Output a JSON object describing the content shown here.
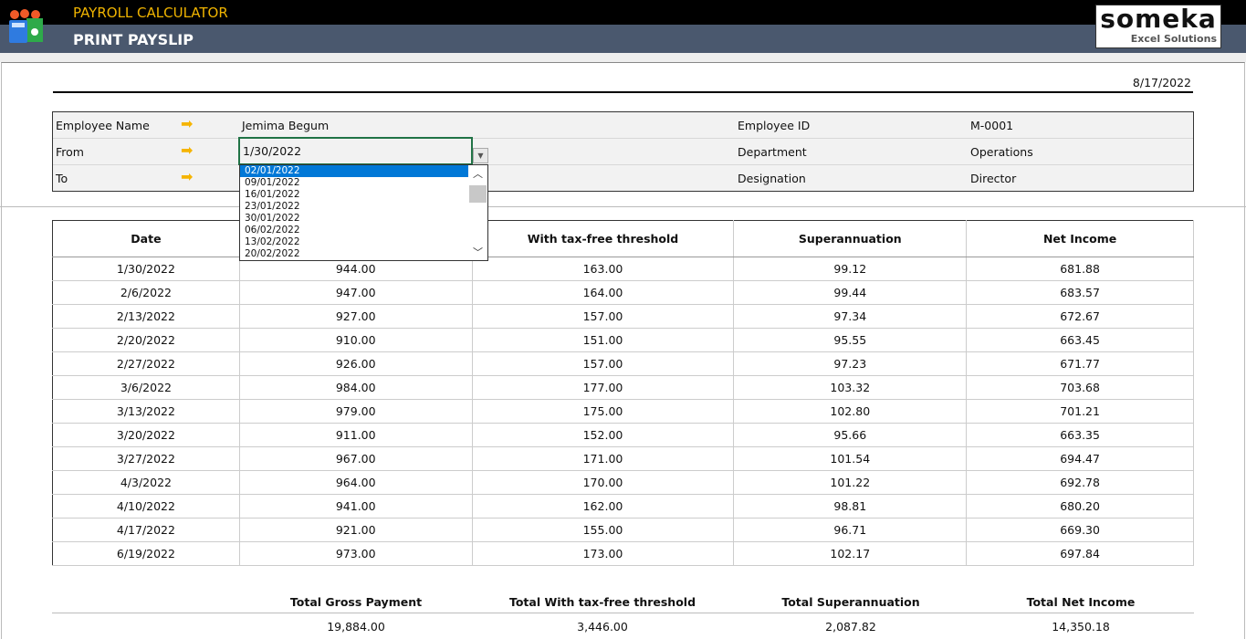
{
  "header": {
    "app_title": "PAYROLL CALCULATOR",
    "page_title": "PRINT PAYSLIP",
    "logo_main": "someka",
    "logo_sub": "Excel Solutions"
  },
  "date": "8/17/2022",
  "info": {
    "employee_name_label": "Employee Name",
    "employee_name": "Jemima Begum",
    "from_label": "From",
    "from": "1/30/2022",
    "to_label": "To",
    "employee_id_label": "Employee ID",
    "employee_id": "M-0001",
    "department_label": "Department",
    "department": "Operations",
    "designation_label": "Designation",
    "designation": "Director"
  },
  "dropdown": {
    "options": [
      "02/01/2022",
      "09/01/2022",
      "16/01/2022",
      "23/01/2022",
      "30/01/2022",
      "06/02/2022",
      "13/02/2022",
      "20/02/2022"
    ],
    "selected": "02/01/2022"
  },
  "table": {
    "headers": [
      "Date",
      "",
      "With tax-free threshold",
      "Superannuation",
      "Net Income"
    ],
    "rows": [
      [
        "1/30/2022",
        "944.00",
        "163.00",
        "99.12",
        "681.88"
      ],
      [
        "2/6/2022",
        "947.00",
        "164.00",
        "99.44",
        "683.57"
      ],
      [
        "2/13/2022",
        "927.00",
        "157.00",
        "97.34",
        "672.67"
      ],
      [
        "2/20/2022",
        "910.00",
        "151.00",
        "95.55",
        "663.45"
      ],
      [
        "2/27/2022",
        "926.00",
        "157.00",
        "97.23",
        "671.77"
      ],
      [
        "3/6/2022",
        "984.00",
        "177.00",
        "103.32",
        "703.68"
      ],
      [
        "3/13/2022",
        "979.00",
        "175.00",
        "102.80",
        "701.21"
      ],
      [
        "3/20/2022",
        "911.00",
        "152.00",
        "95.66",
        "663.35"
      ],
      [
        "3/27/2022",
        "967.00",
        "171.00",
        "101.54",
        "694.47"
      ],
      [
        "4/3/2022",
        "964.00",
        "170.00",
        "101.22",
        "692.78"
      ],
      [
        "4/10/2022",
        "941.00",
        "162.00",
        "98.81",
        "680.20"
      ],
      [
        "4/17/2022",
        "921.00",
        "155.00",
        "96.71",
        "669.30"
      ],
      [
        "6/19/2022",
        "973.00",
        "173.00",
        "102.17",
        "697.84"
      ]
    ]
  },
  "totals": [
    {
      "label": "Total Gross Payment",
      "value": "19,884.00"
    },
    {
      "label": "Total With tax-free threshold",
      "value": "3,446.00"
    },
    {
      "label": "Total Superannuation",
      "value": "2,087.82"
    },
    {
      "label": "Total Net Income",
      "value": "14,350.18"
    }
  ],
  "colors": {
    "header_bg": "#000000",
    "subheader_bg": "#4a586e",
    "title_accent": "#f0b400",
    "arrow": "#f5b400",
    "selection": "#0078d7",
    "active_cell_border": "#217346"
  }
}
